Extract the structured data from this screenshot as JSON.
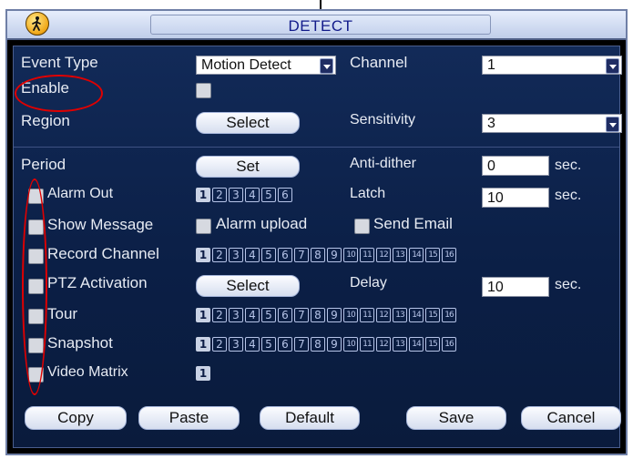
{
  "window": {
    "title": "DETECT",
    "icon": "walking-person-icon"
  },
  "fields": {
    "event_type": {
      "label": "Event Type",
      "value": "Motion Detect"
    },
    "channel": {
      "label": "Channel",
      "value": "1"
    },
    "enable": {
      "label": "Enable",
      "checked": false
    },
    "region": {
      "label": "Region",
      "button": "Select"
    },
    "sensitivity": {
      "label": "Sensitivity",
      "value": "3"
    },
    "period": {
      "label": "Period",
      "button": "Set"
    },
    "anti_dither": {
      "label": "Anti-dither",
      "value": "0",
      "unit": "sec."
    },
    "alarm_out": {
      "label": "Alarm Out",
      "numbers": [
        "1",
        "2",
        "3",
        "4",
        "5",
        "6"
      ],
      "selected": [
        "1"
      ]
    },
    "latch": {
      "label": "Latch",
      "value": "10",
      "unit": "sec."
    },
    "show_message": {
      "label": "Show Message"
    },
    "alarm_upload": {
      "label": "Alarm upload"
    },
    "send_email": {
      "label": "Send Email"
    },
    "record_channel": {
      "label": "Record Channel",
      "numbers": [
        "1",
        "2",
        "3",
        "4",
        "5",
        "6",
        "7",
        "8",
        "9",
        "10",
        "11",
        "12",
        "13",
        "14",
        "15",
        "16"
      ],
      "selected": [
        "1"
      ]
    },
    "ptz_activation": {
      "label": "PTZ Activation",
      "button": "Select"
    },
    "delay": {
      "label": "Delay",
      "value": "10",
      "unit": "sec."
    },
    "tour": {
      "label": "Tour",
      "numbers": [
        "1",
        "2",
        "3",
        "4",
        "5",
        "6",
        "7",
        "8",
        "9",
        "10",
        "11",
        "12",
        "13",
        "14",
        "15",
        "16"
      ],
      "selected": [
        "1"
      ]
    },
    "snapshot": {
      "label": "Snapshot",
      "numbers": [
        "1",
        "2",
        "3",
        "4",
        "5",
        "6",
        "7",
        "8",
        "9",
        "10",
        "11",
        "12",
        "13",
        "14",
        "15",
        "16"
      ],
      "selected": [
        "1"
      ]
    },
    "video_matrix": {
      "label": "Video Matrix",
      "numbers": [
        "1"
      ],
      "selected": [
        "1"
      ]
    }
  },
  "buttons": {
    "copy": "Copy",
    "paste": "Paste",
    "default": "Default",
    "save": "Save",
    "cancel": "Cancel"
  },
  "colors": {
    "annotation": "#e00000",
    "panel": "#0b1f46",
    "title_text": "#121b8a"
  }
}
